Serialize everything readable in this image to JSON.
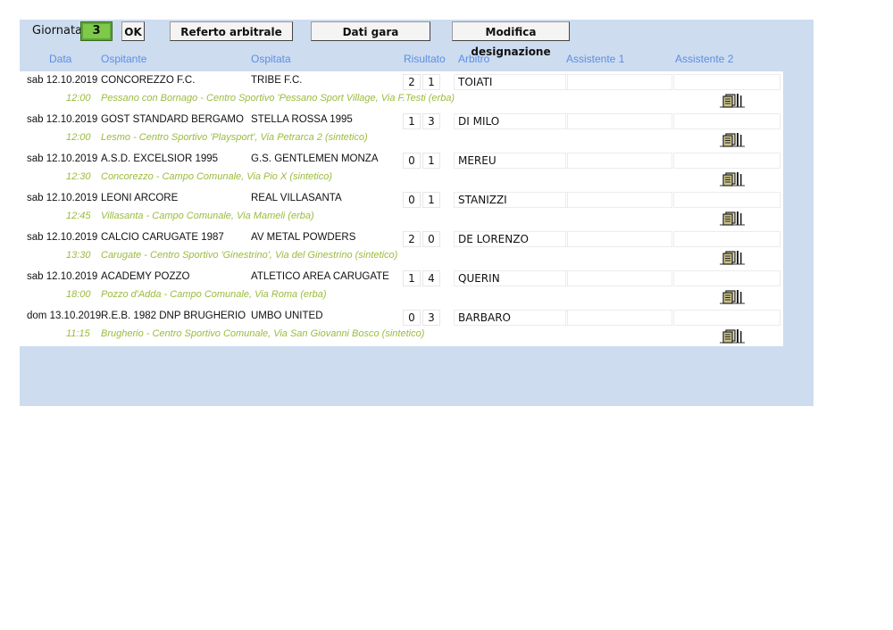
{
  "toolbar": {
    "giornata_label": "Giornata:",
    "giornata_value": "3",
    "ok_label": "OK",
    "referto_label": "Referto arbitrale",
    "dati_label": "Dati gara",
    "modifica_label": "Modifica designazione"
  },
  "headers": {
    "data": "Data",
    "ospitante": "Ospitante",
    "ospitata": "Ospitata",
    "risultato": "Risultato",
    "arbitro": "Arbitro",
    "assistente1": "Assistente 1",
    "assistente2": "Assistente 2"
  },
  "colors": {
    "accent_header": "#5b8ee6",
    "location_text": "#9bbb3c",
    "panel_bg": "#cddcef",
    "giornata_bg": "#7ec84a"
  },
  "matches": [
    {
      "date": "sab 12.10.2019",
      "time": "12:00",
      "host": "CONCOREZZO F.C.",
      "guest": "TRIBE F.C.",
      "score_home": "2",
      "score_away": "1",
      "referee": "TOIATI",
      "location": "Pessano con Bornago - Centro Sportivo 'Pessano Sport Village, Via F.Testi (erba)"
    },
    {
      "date": "sab 12.10.2019",
      "time": "12:00",
      "host": "GOST STANDARD BERGAMO",
      "guest": "STELLA ROSSA 1995",
      "score_home": "1",
      "score_away": "3",
      "referee": "DI MILO",
      "location": "Lesmo - Centro Sportivo 'Playsport', Via Petrarca 2 (sintetico)"
    },
    {
      "date": "sab 12.10.2019",
      "time": "12:30",
      "host": "A.S.D. EXCELSIOR 1995",
      "guest": "G.S. GENTLEMEN MONZA",
      "score_home": "0",
      "score_away": "1",
      "referee": "MEREU",
      "location": "Concorezzo - Campo Comunale, Via Pio X (sintetico)"
    },
    {
      "date": "sab 12.10.2019",
      "time": "12:45",
      "host": "LEONI ARCORE",
      "guest": "REAL VILLASANTA",
      "score_home": "0",
      "score_away": "1",
      "referee": "STANIZZI",
      "location": "Villasanta - Campo Comunale, Via Mameli (erba)"
    },
    {
      "date": "sab 12.10.2019",
      "time": "13:30",
      "host": "CALCIO CARUGATE 1987",
      "guest": "AV METAL POWDERS",
      "score_home": "2",
      "score_away": "0",
      "referee": "DE LORENZO",
      "location": "Carugate - Centro Sportivo 'Ginestrino', Via del Ginestrino (sintetico)"
    },
    {
      "date": "sab 12.10.2019",
      "time": "18:00",
      "host": "ACADEMY POZZO",
      "guest": "ATLETICO AREA CARUGATE",
      "score_home": "1",
      "score_away": "4",
      "referee": "QUERIN",
      "location": "Pozzo d'Adda - Campo Comunale, Via Roma (erba)"
    },
    {
      "date": "dom 13.10.2019",
      "time": "11:15",
      "host": "R.E.B. 1982 DNP BRUGHERIO",
      "guest": "UMBO UNITED",
      "score_home": "0",
      "score_away": "3",
      "referee": "BARBARO",
      "location": "Brugherio - Centro Sportivo Comunale, Via San Giovanni Bosco (sintetico)"
    }
  ]
}
